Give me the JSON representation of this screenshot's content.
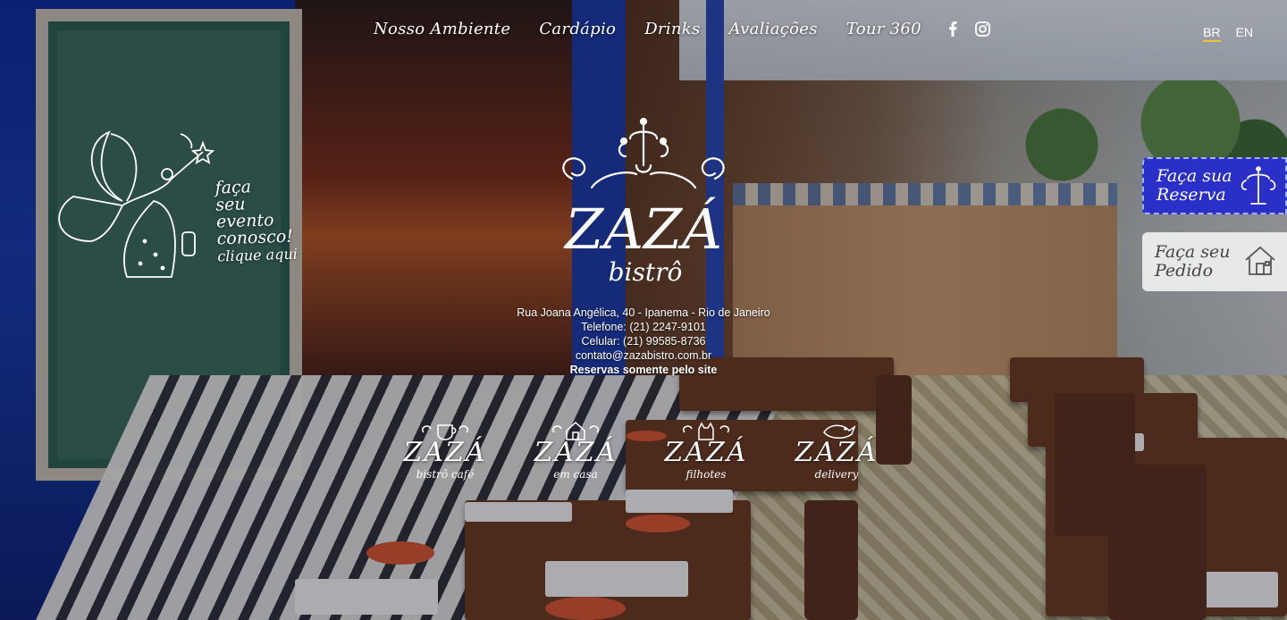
{
  "nav": {
    "items": [
      "Nosso Ambiente",
      "Cardápio",
      "Drinks",
      "Avaliações",
      "Tour 360"
    ],
    "social": [
      "facebook-icon",
      "instagram-icon"
    ]
  },
  "lang": {
    "br": "BR",
    "en": "EN",
    "active": "BR"
  },
  "logo": {
    "name": "ZAZÁ",
    "sub": "bistrô"
  },
  "info": {
    "address": "Rua Joana Angélica, 40 - Ipanema - Rio de Janeiro",
    "phone": "Telefone: (21) 2247-9101",
    "mobile": "Celular: (21) 99585-8736",
    "email": "contato@zazabistro.com.br",
    "note": "Reservas somente pelo site"
  },
  "event": {
    "line1": "faça",
    "line2": "seu",
    "line3": "evento",
    "line4": "conosco!",
    "line5": "clique aqui"
  },
  "brands": [
    {
      "name": "ZAZÁ",
      "sub": "bistrô café",
      "icon": "coffee-cup-icon"
    },
    {
      "name": "ZAZÁ",
      "sub": "em casa",
      "icon": "house-icon"
    },
    {
      "name": "ZAZÁ",
      "sub": "filhotes",
      "icon": "cat-icon"
    },
    {
      "name": "ZAZÁ",
      "sub": "delivery",
      "icon": "bird-icon"
    }
  ],
  "side": {
    "reserva": "Faça sua Reserva",
    "pedido": "Faça seu Pedido"
  },
  "colors": {
    "accent": "#2a2fc7",
    "underline": "#f1c232"
  }
}
